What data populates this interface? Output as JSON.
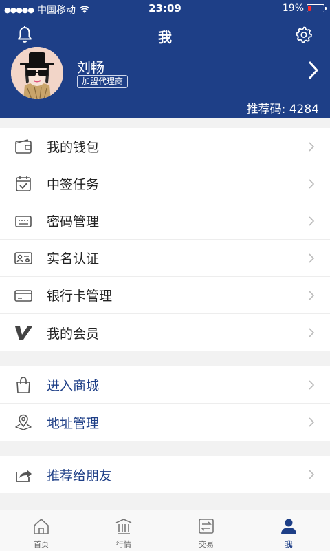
{
  "status_bar": {
    "carrier": "中国移动",
    "time": "23:09",
    "battery_percent_text": "19%",
    "battery_level": 0.19,
    "signal_bars": 5
  },
  "header": {
    "title": "我",
    "user": {
      "name": "刘畅",
      "role": "加盟代理商"
    },
    "referral_code": "推荐码: 4284"
  },
  "menu_groups": [
    {
      "items": [
        {
          "label": "我的钱包",
          "icon": "wallet-icon"
        },
        {
          "label": "中签任务",
          "icon": "calendar-check-icon"
        },
        {
          "label": "密码管理",
          "icon": "password-icon"
        },
        {
          "label": "实名认证",
          "icon": "id-card-icon"
        },
        {
          "label": "银行卡管理",
          "icon": "bank-card-icon"
        },
        {
          "label": "我的会员",
          "icon": "vip-icon"
        }
      ]
    },
    {
      "items": [
        {
          "label": "进入商城",
          "icon": "shopping-bag-icon"
        },
        {
          "label": "地址管理",
          "icon": "map-pin-icon"
        }
      ]
    },
    {
      "items": [
        {
          "label": "推荐给朋友",
          "icon": "share-icon"
        }
      ]
    }
  ],
  "tab_bar": {
    "tabs": [
      {
        "label": "首页",
        "icon": "home-icon"
      },
      {
        "label": "行情",
        "icon": "market-icon"
      },
      {
        "label": "交易",
        "icon": "trade-icon"
      },
      {
        "label": "我",
        "icon": "user-icon"
      }
    ],
    "active_index": 3
  },
  "colors": {
    "brand": "#1e3f87",
    "background": "#f2f2f2",
    "battery_low": "#ff2b2b"
  }
}
